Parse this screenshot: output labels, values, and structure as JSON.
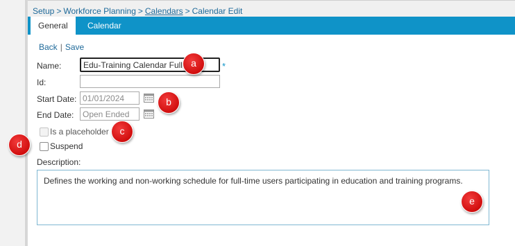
{
  "breadcrumb": {
    "items": [
      "Setup",
      "Workforce Planning",
      "Calendars",
      "Calendar Edit"
    ],
    "separator": ">"
  },
  "tabs": [
    {
      "label": "General",
      "active": true
    },
    {
      "label": "Calendar",
      "active": false
    }
  ],
  "actions": {
    "back_label": "Back",
    "save_label": "Save",
    "divider": "|"
  },
  "form": {
    "name_label": "Name:",
    "name_value": "Edu-Training Calendar Full",
    "required_marker": "*",
    "id_label": "Id:",
    "id_value": "",
    "start_date_label": "Start Date:",
    "start_date_value": "01/01/2024",
    "end_date_label": "End Date:",
    "end_date_placeholder": "Open Ended",
    "placeholder_label": "Is a placeholder",
    "placeholder_checked": false,
    "suspend_label": "Suspend",
    "suspend_checked": false,
    "description_label": "Description:",
    "description_value": "Defines the working and non-working schedule for full-time users participating in education and training programs."
  },
  "markers": [
    "a",
    "b",
    "c",
    "d",
    "e"
  ],
  "colors": {
    "accent": "#0f93c8",
    "link": "#1f6a9a",
    "marker": "#d10e0e"
  },
  "icons": {
    "date_picker": "calendar-icon"
  }
}
